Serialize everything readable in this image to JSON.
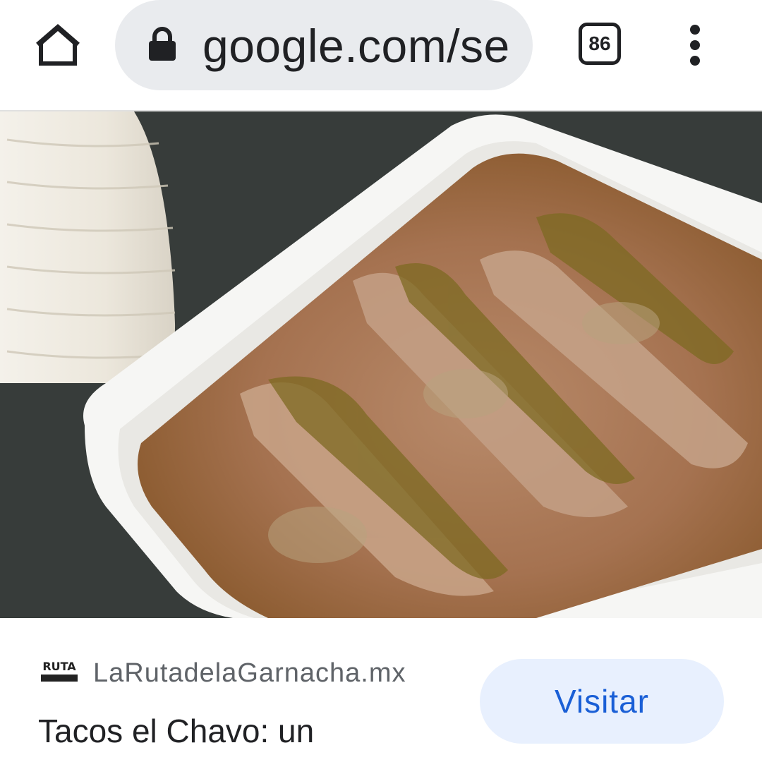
{
  "browser": {
    "url": "google.com/se",
    "tab_count": "86",
    "home_icon": "home-icon",
    "lock_icon": "lock-icon",
    "menu_icon": "more-vert-icon"
  },
  "result": {
    "favicon_text": "RUTA",
    "source": "LaRutadelaGarnacha.mx",
    "title": "Tacos el Chavo: un",
    "visit_label": "Visitar"
  },
  "colors": {
    "accent": "#1a5fd6",
    "button_bg": "#e8f0fe",
    "omnibox_bg": "#e9ebee"
  }
}
